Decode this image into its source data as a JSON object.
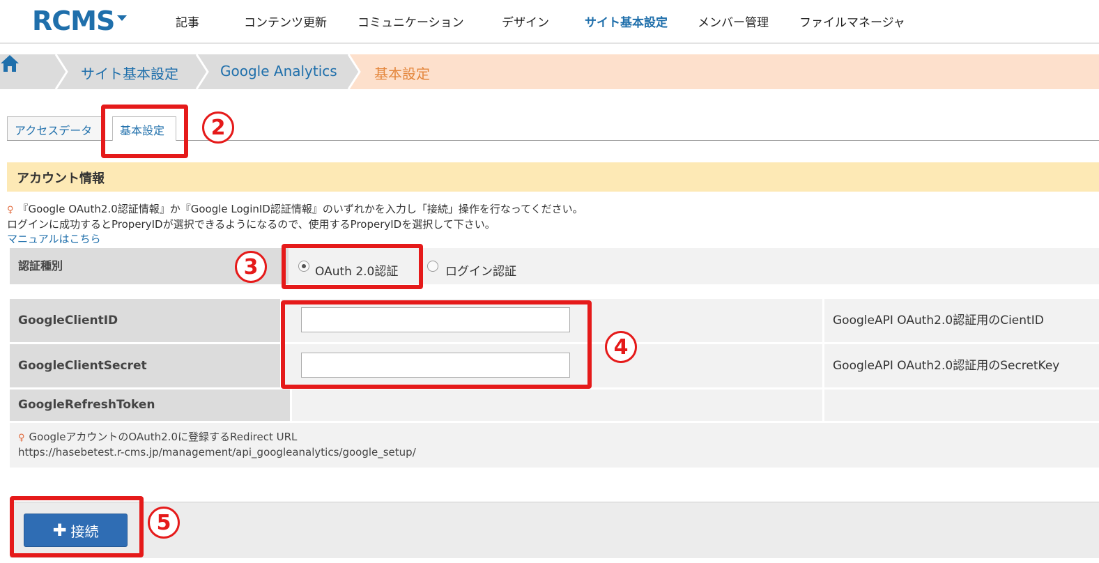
{
  "app": {
    "logo": "RCMS"
  },
  "nav": {
    "items": [
      "記事",
      "コンテンツ更新",
      "コミュニケーション",
      "デザイン",
      "サイト基本設定",
      "メンバー管理",
      "ファイルマネージャ"
    ],
    "active": "サイト基本設定"
  },
  "breadcrumb": {
    "home_icon": "home-icon",
    "items": [
      "サイト基本設定",
      "Google Analytics",
      "基本設定"
    ]
  },
  "tabs": [
    {
      "label": "アクセスデータ",
      "active": false
    },
    {
      "label": "基本設定",
      "active": true
    }
  ],
  "annotations": {
    "n2": "2",
    "n3": "3",
    "n4": "4",
    "n5": "5"
  },
  "section": {
    "title": "アカウント情報"
  },
  "notice": {
    "line1": "『Google OAuth2.0認証情報』か『Google LoginID認証情報』のいずれかを入力し「接続」操作を行なってください。",
    "line2": "ログインに成功するとProperyIDが選択できるようになるので、使用するProperyIDを選択して下さい。",
    "manual_link": "マニュアルはこちら"
  },
  "form": {
    "auth_type": {
      "label": "認証種別",
      "options": [
        "OAuth 2.0認証",
        "ログイン認証"
      ],
      "selected": "OAuth 2.0認証"
    },
    "client_id": {
      "label": "GoogleClientID",
      "value": "",
      "description": "GoogleAPI OAuth2.0認証用のCientID"
    },
    "client_secret": {
      "label": "GoogleClientSecret",
      "value": "",
      "description": "GoogleAPI OAuth2.0認証用のSecretKey"
    },
    "refresh_token": {
      "label": "GoogleRefreshToken",
      "value": "",
      "description": ""
    },
    "redirect": {
      "title": "GoogleアカウントのOAuth2.0に登録するRedirect URL",
      "url": "https://hasebetest.r-cms.jp/management/api_googleanalytics/google_setup/"
    }
  },
  "actions": {
    "connect_label": "接続"
  },
  "colors": {
    "accent": "#1f6fab",
    "annotation_red": "#e51a1a",
    "button_blue": "#2f6db4",
    "breadcrumb_bg": "#fde0cc",
    "section_bg": "#fde9b5"
  }
}
